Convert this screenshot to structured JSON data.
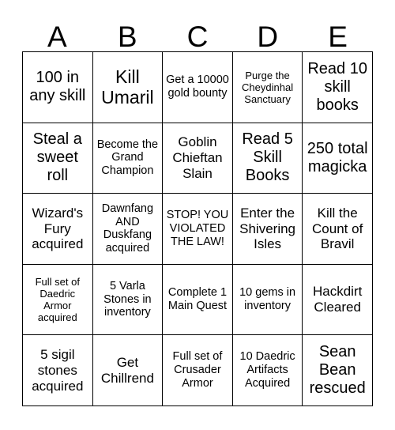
{
  "card": {
    "columns": [
      "A",
      "B",
      "C",
      "D",
      "E"
    ],
    "rows": [
      [
        {
          "text": "100 in any skill",
          "size": "lg"
        },
        {
          "text": "Kill Umaril",
          "size": "xl"
        },
        {
          "text": "Get a 10000 gold bounty",
          "size": "sm"
        },
        {
          "text": "Purge the Cheydinhal Sanctuary",
          "size": "xs"
        },
        {
          "text": "Read 10 skill books",
          "size": "lg"
        }
      ],
      [
        {
          "text": "Steal a sweet roll",
          "size": "lg"
        },
        {
          "text": "Become the Grand Champion",
          "size": "sm"
        },
        {
          "text": "Goblin Chieftan Slain",
          "size": "md"
        },
        {
          "text": "Read 5 Skill Books",
          "size": "lg"
        },
        {
          "text": "250 total magicka",
          "size": "lg"
        }
      ],
      [
        {
          "text": "Wizard's Fury acquired",
          "size": "md"
        },
        {
          "text": "Dawnfang AND Duskfang acquired",
          "size": "sm"
        },
        {
          "text": "STOP! YOU VIOLATED THE LAW!",
          "size": "sm"
        },
        {
          "text": "Enter the Shivering Isles",
          "size": "md"
        },
        {
          "text": "Kill the Count of Bravil",
          "size": "md"
        }
      ],
      [
        {
          "text": "Full set of Daedric Armor acquired",
          "size": "xs"
        },
        {
          "text": "5 Varla Stones in inventory",
          "size": "sm"
        },
        {
          "text": "Complete 1 Main Quest",
          "size": "sm"
        },
        {
          "text": "10 gems in inventory",
          "size": "sm"
        },
        {
          "text": "Hackdirt Cleared",
          "size": "md"
        }
      ],
      [
        {
          "text": "5 sigil stones acquired",
          "size": "md"
        },
        {
          "text": "Get Chillrend",
          "size": "md"
        },
        {
          "text": "Full set of Crusader Armor",
          "size": "sm"
        },
        {
          "text": "10 Daedric Artifacts Acquired",
          "size": "sm"
        },
        {
          "text": "Sean Bean rescued",
          "size": "lg"
        }
      ]
    ]
  },
  "colors": {
    "background": "#ffffff",
    "text": "#000000",
    "grid_line": "#000000"
  }
}
